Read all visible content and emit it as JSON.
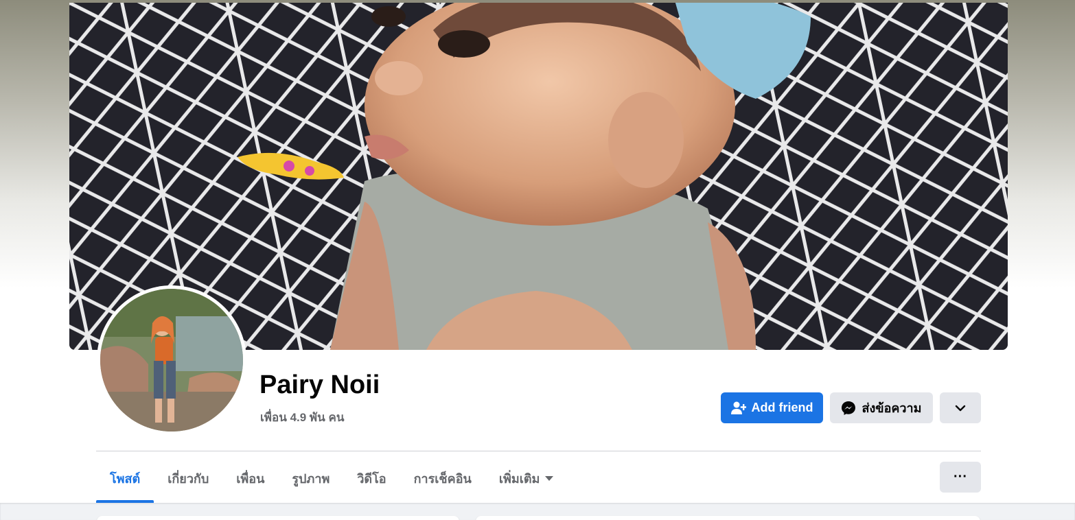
{
  "profile": {
    "name": "Pairy Noii",
    "friends_count": "เพื่อน 4.9 พัน คน"
  },
  "actions": {
    "add_friend_label": "Add friend",
    "message_label": "ส่งข้อความ",
    "more_icon": "chevron-down-icon",
    "add_friend_icon": "user-plus-icon",
    "message_icon": "messenger-icon"
  },
  "tabs": [
    {
      "label": "โพสต์",
      "active": true
    },
    {
      "label": "เกี่ยวกับ",
      "active": false
    },
    {
      "label": "เพื่อน",
      "active": false
    },
    {
      "label": "รูปภาพ",
      "active": false
    },
    {
      "label": "วิดีโอ",
      "active": false
    },
    {
      "label": "การเช็คอิน",
      "active": false
    },
    {
      "label": "เพิ่มเติม",
      "active": false
    }
  ],
  "tab_overflow_label": "···",
  "colors": {
    "accent": "#1b74e4",
    "secondary_button": "#e4e6eb",
    "text_primary": "#050505",
    "text_secondary": "#65676b",
    "page_background": "#f0f2f5"
  }
}
